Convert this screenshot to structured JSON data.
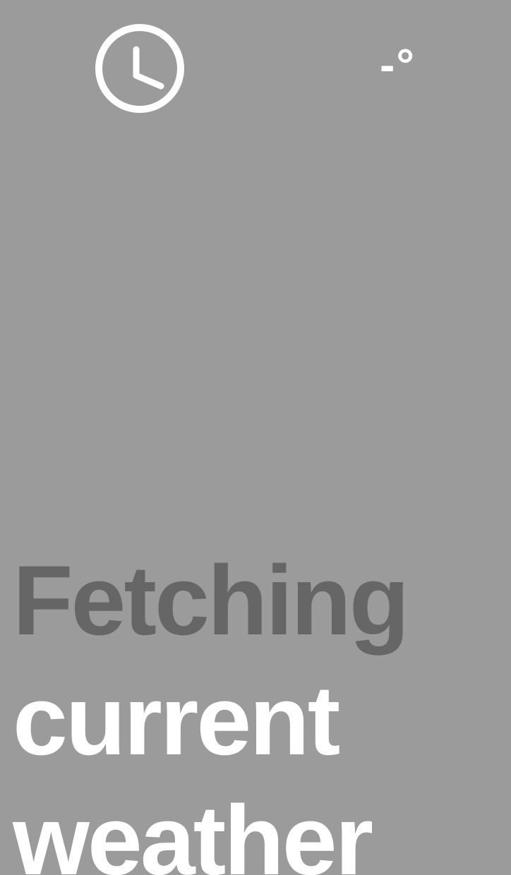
{
  "header": {
    "clock_icon": "clock-icon",
    "temperature": "-°"
  },
  "status": {
    "line1": "Fetching",
    "line2": "current",
    "line3": "weather"
  },
  "colors": {
    "background": "#9b9b9b",
    "text_primary": "#ffffff",
    "text_dim": "#666666"
  }
}
